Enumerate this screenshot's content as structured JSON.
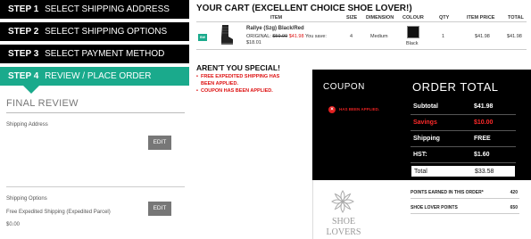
{
  "steps": [
    {
      "num": "STEP  1",
      "label": "SELECT SHIPPING ADDRESS"
    },
    {
      "num": "STEP  2",
      "label": "SELECT SHIPPING OPTIONS"
    },
    {
      "num": "STEP  3",
      "label": "SELECT PAYMENT METHOD"
    },
    {
      "num": "STEP  4",
      "label": "REVIEW / PLACE ORDER"
    }
  ],
  "final_review": {
    "title": "FINAL REVIEW",
    "shipping_address_label": "Shipping Address",
    "edit_label": "EDIT",
    "shipping_options_label": "Shipping Options",
    "shipping_option_value": "Free Expedited Shipping (Expedited Parcel)",
    "shipping_cost": "$0.00"
  },
  "cart": {
    "title": "YOUR CART (EXCELLENT CHOICE SHOE LOVER!)",
    "headers": {
      "item": "ITEM",
      "size": "SIZE",
      "dimension": "DIMENSION",
      "colour": "COLOUR",
      "qty": "QTY",
      "item_price": "ITEM PRICE",
      "total": "TOTAL"
    },
    "row": {
      "badge": "SW",
      "name": "Rallye (Szg) Black/Red",
      "original_label": "ORIGINAL:",
      "original_price": "$59.99",
      "sale_price": "$41.98",
      "you_save_label": "You save:",
      "you_save": "$18.01",
      "size": "4",
      "dimension": "Medium",
      "colour": "Black",
      "qty": "1",
      "item_price": "$41.98",
      "total": "$41.98"
    }
  },
  "special": {
    "title": "AREN'T YOU SPECIAL!",
    "messages": [
      "FREE EXPEDITED SHIPPING HAS BEEN APPLIED.",
      "COUPON HAS BEEN APPLIED."
    ]
  },
  "coupon": {
    "title": "COUPON",
    "status": "HAS BEEN APPLIED."
  },
  "order_total": {
    "title": "ORDER TOTAL",
    "rows": [
      {
        "label": "Subtotal",
        "value": "$41.98"
      },
      {
        "label": "Savings",
        "value": "$10.00"
      },
      {
        "label": "Shipping",
        "value": "FREE"
      },
      {
        "label": "HST:",
        "value": "$1.60"
      },
      {
        "label": "Total",
        "value": "$33.58"
      }
    ]
  },
  "points": {
    "logo_text_1": "SHOE",
    "logo_text_2": "LOVERS",
    "rows": [
      {
        "label": "POINTS EARNED IN THIS ORDER*",
        "value": "420"
      },
      {
        "label": "SHOE LOVER POINTS",
        "value": "650"
      }
    ]
  },
  "colors": {
    "accent": "#1aaa8c",
    "panel": "#000000",
    "alert": "#dd1111"
  }
}
